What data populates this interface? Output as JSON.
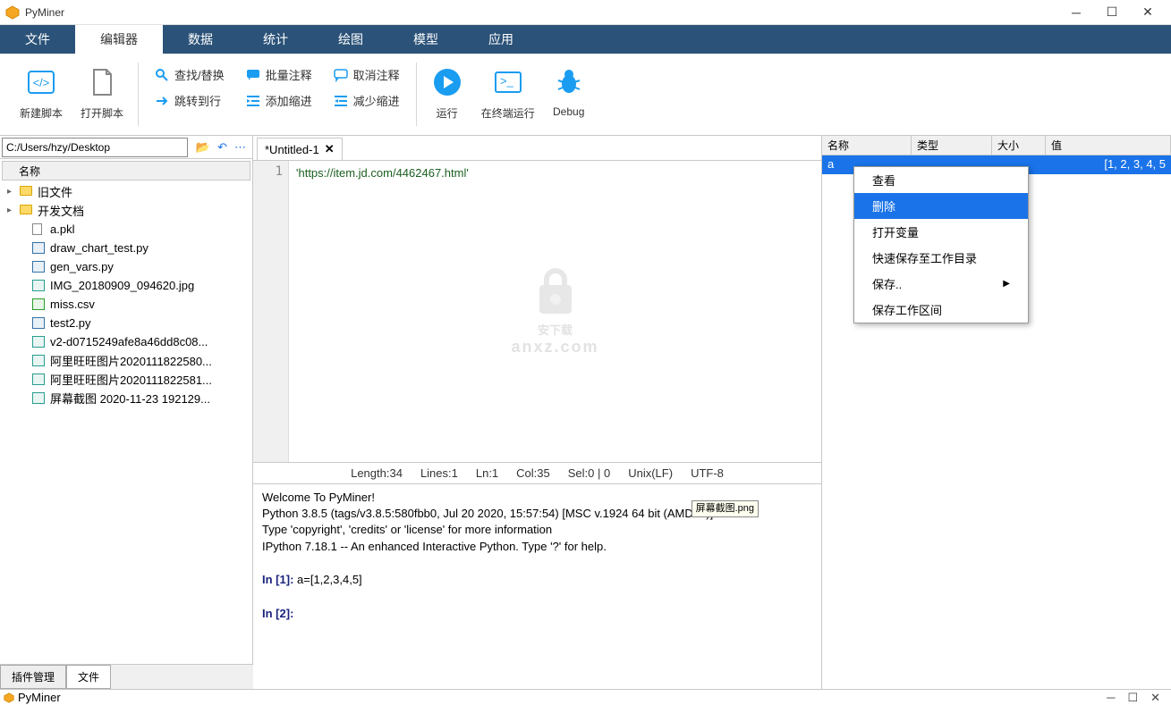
{
  "app": {
    "title": "PyMiner"
  },
  "menu": {
    "tabs": [
      "文件",
      "编辑器",
      "数据",
      "统计",
      "绘图",
      "模型",
      "应用"
    ],
    "active": 1
  },
  "ribbon": {
    "big": [
      {
        "label": "新建脚本",
        "icon": "code"
      },
      {
        "label": "打开脚本",
        "icon": "file"
      }
    ],
    "col1": [
      {
        "label": "查找/替换",
        "icon": "search"
      },
      {
        "label": "跳转到行",
        "icon": "goto"
      }
    ],
    "col2": [
      {
        "label": "批量注释",
        "icon": "comment"
      },
      {
        "label": "添加缩进",
        "icon": "indent"
      }
    ],
    "col3": [
      {
        "label": "取消注释",
        "icon": "uncomment"
      },
      {
        "label": "减少缩进",
        "icon": "outdent"
      }
    ],
    "big2": [
      {
        "label": "运行",
        "icon": "play"
      },
      {
        "label": "在终端运行",
        "icon": "terminal"
      },
      {
        "label": "Debug",
        "icon": "bug"
      }
    ]
  },
  "path": {
    "value": "C:/Users/hzy/Desktop"
  },
  "file_header": "名称",
  "files": [
    {
      "name": "旧文件",
      "type": "folder",
      "expand": true
    },
    {
      "name": "开发文档",
      "type": "folder",
      "expand": true
    },
    {
      "name": "a.pkl",
      "type": "file"
    },
    {
      "name": "draw_chart_test.py",
      "type": "py"
    },
    {
      "name": "gen_vars.py",
      "type": "py"
    },
    {
      "name": "IMG_20180909_094620.jpg",
      "type": "img"
    },
    {
      "name": "miss.csv",
      "type": "csv"
    },
    {
      "name": "test2.py",
      "type": "py"
    },
    {
      "name": "v2-d0715249afe8a46dd8c08...",
      "type": "img"
    },
    {
      "name": "阿里旺旺图片2020111822580...",
      "type": "img"
    },
    {
      "name": "阿里旺旺图片2020111822581...",
      "type": "img"
    },
    {
      "name": "屏幕截图 2020-11-23 192129...",
      "type": "img"
    }
  ],
  "bottom_tabs": {
    "items": [
      "插件管理",
      "文件"
    ],
    "active": 1
  },
  "editor": {
    "tab": "*Untitled-1",
    "line_no": "1",
    "code": "'https://item.jd.com/4462467.html'"
  },
  "status": {
    "length": "Length:34",
    "lines": "Lines:1",
    "ln": "Ln:1",
    "col": "Col:35",
    "sel": "Sel:0 | 0",
    "eol": "Unix(LF)",
    "enc": "UTF-8"
  },
  "console": {
    "l1": "Welcome To PyMiner!",
    "l2": "Python 3.8.5 (tags/v3.8.5:580fbb0, Jul 20 2020, 15:57:54) [MSC v.1924 64 bit (AMD64)]",
    "l3": "Type 'copyright', 'credits' or 'license' for more information",
    "l4": "IPython 7.18.1 -- An enhanced Interactive Python. Type '?' for help.",
    "in1_label": "In [",
    "in1_num": "1",
    "in1_close": "]:",
    "in1_code": " a=[1,2,3,4,5]",
    "in2_label": "In [",
    "in2_num": "2",
    "in2_close": "]:",
    "tooltip": "屏幕截图.png"
  },
  "vars": {
    "cols": [
      "名称",
      "类型",
      "大小",
      "值"
    ],
    "row": {
      "name": "a",
      "value": "[1, 2, 3, 4, 5"
    }
  },
  "ctx": {
    "items": [
      "查看",
      "删除",
      "打开变量",
      "快速保存至工作目录",
      "保存..",
      "保存工作区间"
    ],
    "hover": 1,
    "arrow_idx": 4
  },
  "watermark": {
    "main": "安下载",
    "sub": "anxz.com"
  },
  "taskbar": {
    "title": "PyMiner"
  }
}
